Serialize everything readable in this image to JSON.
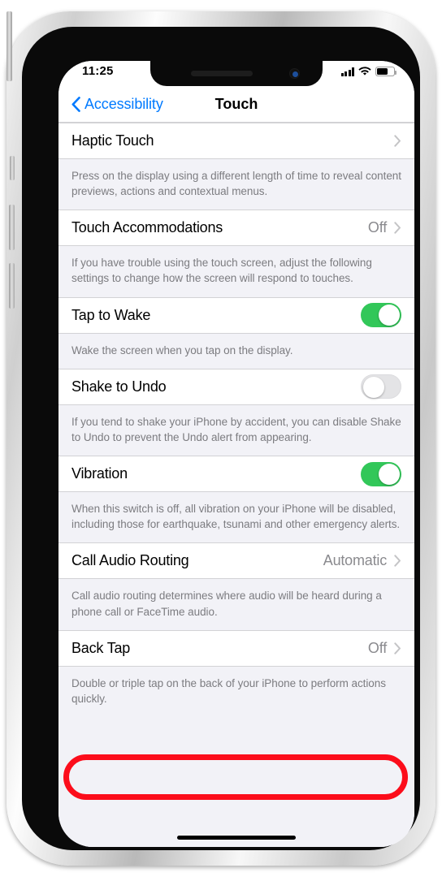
{
  "status_bar": {
    "time": "11:25",
    "signal_icon": "cellular-bars-icon",
    "wifi_icon": "wifi-icon",
    "battery_icon": "battery-icon"
  },
  "nav": {
    "back_label": "Accessibility",
    "back_icon": "chevron-left-icon",
    "title": "Touch"
  },
  "rows": [
    {
      "label": "Haptic Touch",
      "value": "",
      "type": "link",
      "footer": "Press on the display using a different length of time to reveal content previews, actions and contextual menus."
    },
    {
      "label": "Touch Accommodations",
      "value": "Off",
      "type": "link",
      "footer": "If you have trouble using the touch screen, adjust the following settings to change how the screen will respond to touches."
    },
    {
      "label": "Tap to Wake",
      "value": "on",
      "type": "toggle",
      "footer": "Wake the screen when you tap on the display."
    },
    {
      "label": "Shake to Undo",
      "value": "off",
      "type": "toggle",
      "footer": "If you tend to shake your iPhone by accident, you can disable Shake to Undo to prevent the Undo alert from appearing."
    },
    {
      "label": "Vibration",
      "value": "on",
      "type": "toggle",
      "footer": "When this switch is off, all vibration on your iPhone will be disabled, including those for earthquake, tsunami and other emergency alerts."
    },
    {
      "label": "Call Audio Routing",
      "value": "Automatic",
      "type": "link",
      "footer": "Call audio routing determines where audio will be heard during a phone call or FaceTime audio."
    },
    {
      "label": "Back Tap",
      "value": "Off",
      "type": "link",
      "highlighted": true,
      "footer": "Double or triple tap on the back of your iPhone to perform actions quickly."
    }
  ],
  "colors": {
    "accent_blue": "#007aff",
    "toggle_on_green": "#32c759",
    "highlight_red": "#fc0d1b",
    "group_background": "#f2f2f7",
    "secondary_text": "#7c7c80"
  }
}
